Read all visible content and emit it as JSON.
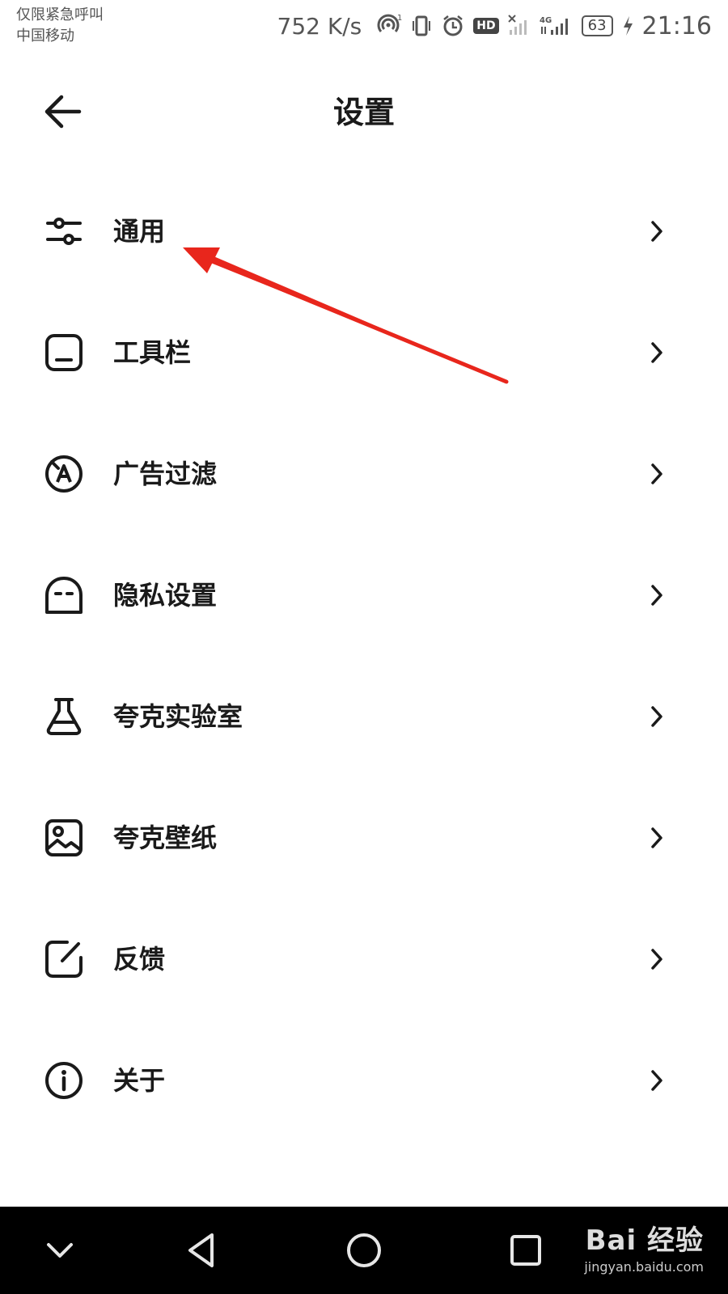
{
  "status_bar": {
    "carrier_line1": "仅限紧急呼叫",
    "carrier_line2": "中国移动",
    "net_speed": "752 K/s",
    "hd": "HD",
    "battery": "63",
    "time": "21:16",
    "icons": [
      "hotspot-icon",
      "vibrate-icon",
      "alarm-icon",
      "hd-icon",
      "signal-no-sim-icon",
      "signal-4g-icon",
      "battery-icon",
      "charging-icon"
    ]
  },
  "header": {
    "title": "设置",
    "back_icon": "arrow-left-icon"
  },
  "menu": {
    "items": [
      {
        "label": "通用",
        "icon": "sliders-icon"
      },
      {
        "label": "工具栏",
        "icon": "toolbar-icon"
      },
      {
        "label": "广告过滤",
        "icon": "ad-block-icon"
      },
      {
        "label": "隐私设置",
        "icon": "privacy-icon"
      },
      {
        "label": "夸克实验室",
        "icon": "flask-icon"
      },
      {
        "label": "夸克壁纸",
        "icon": "wallpaper-icon"
      },
      {
        "label": "反馈",
        "icon": "feedback-icon"
      },
      {
        "label": "关于",
        "icon": "info-icon"
      }
    ]
  },
  "annotation": {
    "type": "arrow",
    "color": "#e8261c",
    "points_to": "通用"
  },
  "nav_bar": {
    "buttons": [
      "chevron-down-icon",
      "back-triangle-icon",
      "home-circle-icon",
      "recents-square-icon"
    ],
    "watermark_logo": "Bai 经验",
    "watermark_url": "jingyan.baidu.com"
  }
}
